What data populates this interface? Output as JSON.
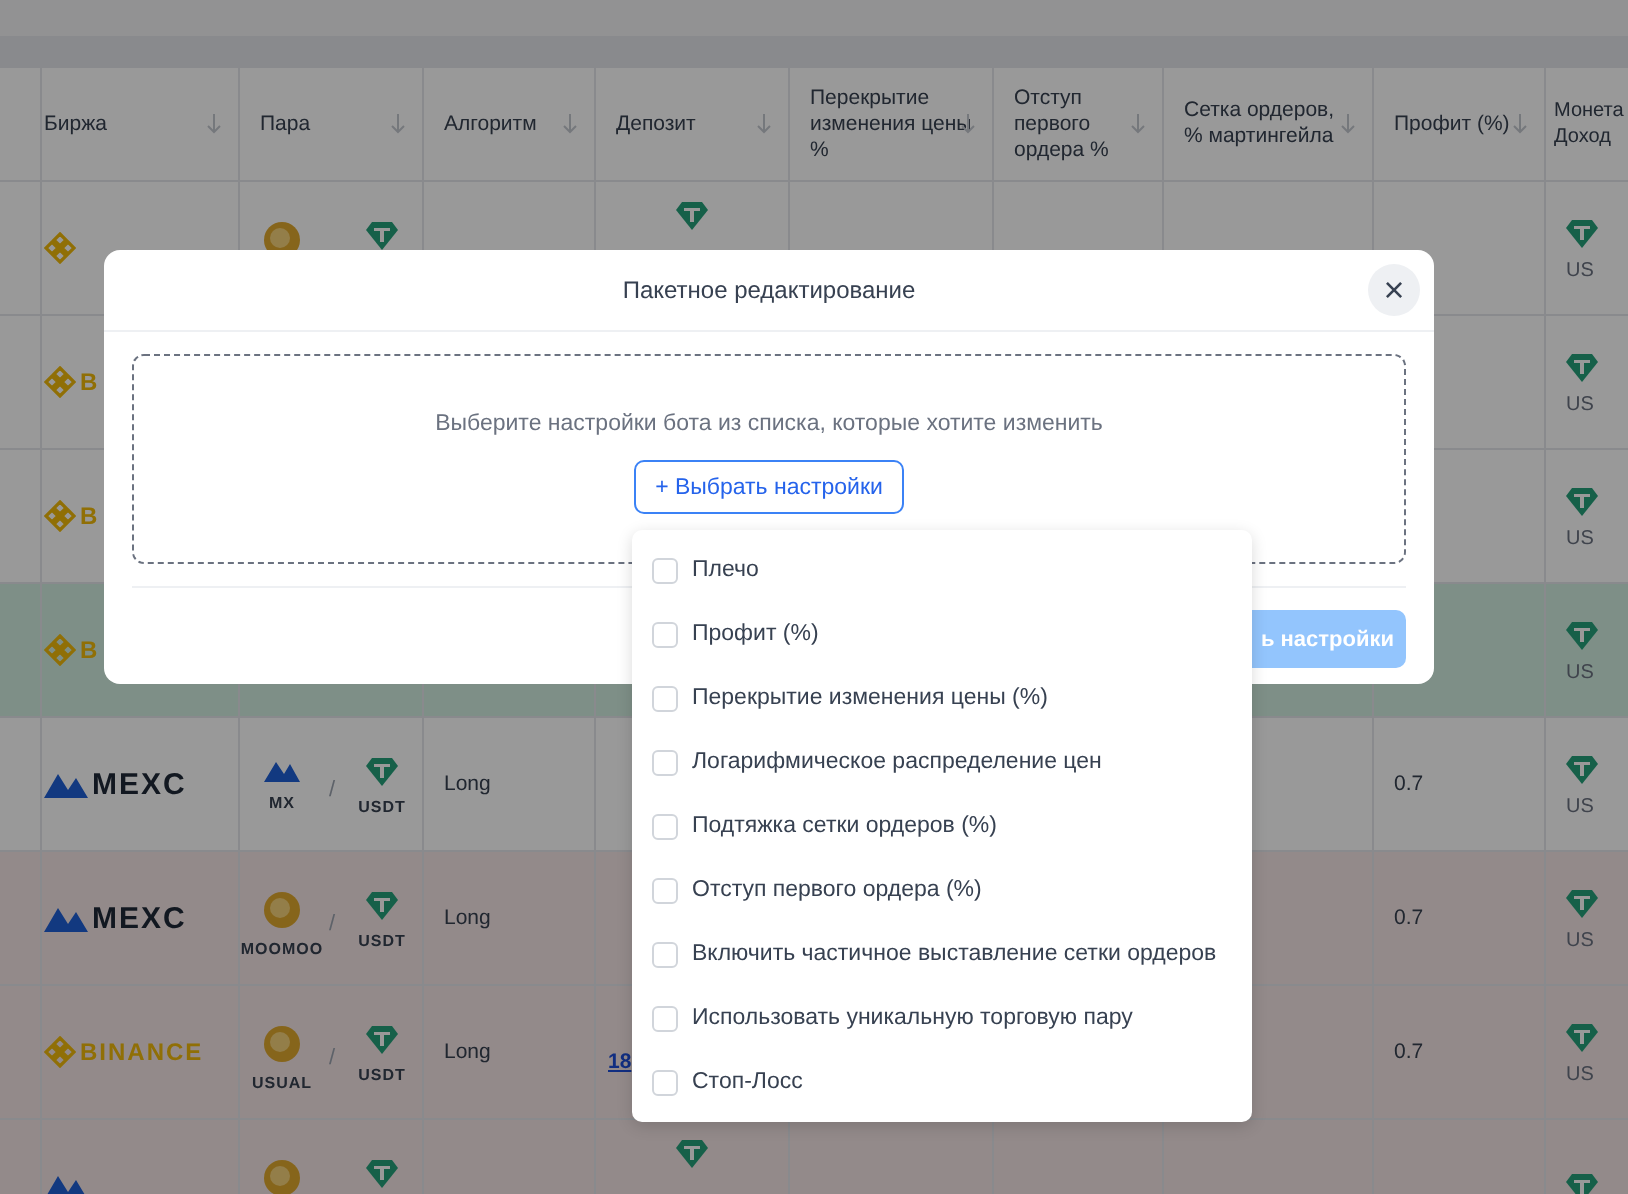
{
  "table": {
    "columns": [
      {
        "label": "Биржа"
      },
      {
        "label": "Пара"
      },
      {
        "label": "Алгоритм"
      },
      {
        "label": "Депозит"
      },
      {
        "label": "Перекрытие изменения цены %"
      },
      {
        "label": "Отступ первого ордера %"
      },
      {
        "label": "Сетка ордеров, % мартингейла"
      },
      {
        "label": "Профит (%)"
      },
      {
        "label": "Монета Доход"
      }
    ],
    "rows": [
      {
        "exchange": {
          "kind": "binance"
        },
        "base": {
          "kind": "gold"
        },
        "quote": {
          "kind": "tether"
        },
        "deposit_icon": true,
        "coin": {
          "label": "US"
        },
        "selected": false,
        "warning": false
      },
      {
        "exchange": {
          "kind": "binance",
          "name": "B"
        },
        "coin": {
          "label": "US"
        },
        "selected": false,
        "warning": false
      },
      {
        "exchange": {
          "kind": "binance",
          "name": "B"
        },
        "coin": {
          "label": "US"
        },
        "selected": false,
        "warning": false
      },
      {
        "exchange": {
          "kind": "binance",
          "name": "B"
        },
        "coin": {
          "label": "US"
        },
        "selected": true,
        "warning": false
      },
      {
        "exchange": {
          "kind": "mexc",
          "name": "MEXC"
        },
        "base": {
          "kind": "mx",
          "label": "MX"
        },
        "separator": "/",
        "quote": {
          "kind": "tether",
          "label": "USDT"
        },
        "algorithm": "Long",
        "profit": "0.7",
        "coin": {
          "label": "US"
        },
        "selected": false,
        "warning": false
      },
      {
        "exchange": {
          "kind": "mexc",
          "name": "MEXC"
        },
        "base": {
          "kind": "gold",
          "label": "MOOMOO"
        },
        "separator": "/",
        "quote": {
          "kind": "tether",
          "label": "USDT"
        },
        "algorithm": "Long",
        "profit": "0.7",
        "coin": {
          "label": "US"
        },
        "selected": false,
        "warning": true
      },
      {
        "exchange": {
          "kind": "binance",
          "name": "BINANCE"
        },
        "base": {
          "kind": "gold",
          "label": "USUAL"
        },
        "separator": "/",
        "quote": {
          "kind": "tether",
          "label": "USDT"
        },
        "algorithm": "Long",
        "deposit": "18",
        "profit": "0.7",
        "coin": {
          "label": "US"
        },
        "selected": false,
        "warning": true
      },
      {
        "exchange": {
          "kind": "mexc"
        },
        "base": {
          "kind": "gold"
        },
        "quote": {
          "kind": "tether"
        },
        "deposit_icon": true,
        "coin": {},
        "selected": false,
        "warning": true
      }
    ]
  },
  "modal": {
    "title": "Пакетное редактирование",
    "close": "×",
    "hint": "Выберите настройки бота из списка, которые хотите изменить",
    "select_button": "+ Выбрать настройки",
    "apply_button": "ь настройки"
  },
  "dropdown": {
    "items": [
      {
        "label": "Плечо",
        "checked": false
      },
      {
        "label": "Профит (%)",
        "checked": false
      },
      {
        "label": "Перекрытие изменения цены (%)",
        "checked": false
      },
      {
        "label": "Логарифмическое распределение цен",
        "checked": false
      },
      {
        "label": "Подтяжка сетки ордеров (%)",
        "checked": false
      },
      {
        "label": "Отступ первого ордера (%)",
        "checked": false
      },
      {
        "label": "Включить частичное выставление сетки ордеров",
        "checked": false
      },
      {
        "label": "Использовать уникальную торговую пару",
        "checked": false
      },
      {
        "label": "Стоп-Лосс",
        "checked": false
      }
    ]
  }
}
